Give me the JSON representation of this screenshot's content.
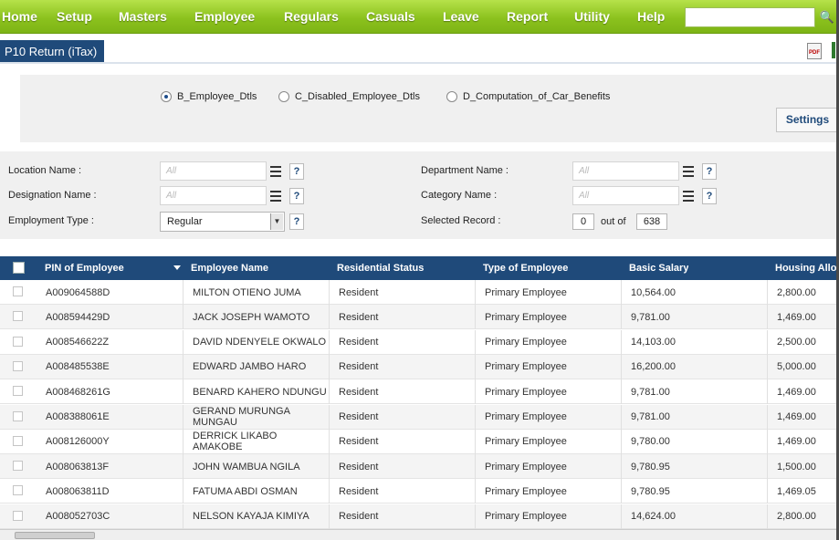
{
  "nav": {
    "items": [
      "Home",
      "Setup",
      "Masters",
      "Employee",
      "Regulars",
      "Casuals",
      "Leave",
      "Report",
      "Utility",
      "Help"
    ],
    "search_icon": "search-icon"
  },
  "page": {
    "title": "P10 Return (iTax)",
    "export_icon": "pdf-export-icon"
  },
  "options": {
    "radios": [
      {
        "label": "B_Employee_Dtls",
        "checked": true
      },
      {
        "label": "C_Disabled_Employee_Dtls",
        "checked": false
      },
      {
        "label": "D_Computation_of_Car_Benefits",
        "checked": false
      }
    ],
    "settings_label": "Settings"
  },
  "filters": {
    "location_label": "Location Name :",
    "designation_label": "Designation Name :",
    "employment_type_label": "Employment Type :",
    "department_label": "Department Name :",
    "category_label": "Category Name :",
    "selected_record_label": "Selected Record :",
    "placeholder": "All",
    "employment_type_value": "Regular",
    "selected_count": "0",
    "out_of_label": "out of",
    "total_count": "638",
    "help_label": "?"
  },
  "table": {
    "columns": [
      "PIN of Employee",
      "Employee Name",
      "Residential Status",
      "Type of Employee",
      "Basic Salary",
      "Housing Allowance"
    ],
    "rows": [
      [
        "A009064588D",
        "MILTON OTIENO JUMA",
        "Resident",
        "Primary Employee",
        "10,564.00",
        "2,800.00"
      ],
      [
        "A008594429D",
        "JACK JOSEPH WAMOTO",
        "Resident",
        "Primary Employee",
        "9,781.00",
        "1,469.00"
      ],
      [
        "A008546622Z",
        "DAVID NDENYELE OKWALO",
        "Resident",
        "Primary Employee",
        "14,103.00",
        "2,500.00"
      ],
      [
        "A008485538E",
        "EDWARD JAMBO HARO",
        "Resident",
        "Primary Employee",
        "16,200.00",
        "5,000.00"
      ],
      [
        "A008468261G",
        "BENARD KAHERO NDUNGU",
        "Resident",
        "Primary Employee",
        "9,781.00",
        "1,469.00"
      ],
      [
        "A008388061E",
        "GERAND MURUNGA MUNGAU",
        "Resident",
        "Primary Employee",
        "9,781.00",
        "1,469.00"
      ],
      [
        "A008126000Y",
        "DERRICK LIKABO AMAKOBE",
        "Resident",
        "Primary Employee",
        "9,780.00",
        "1,469.00"
      ],
      [
        "A008063813F",
        "JOHN WAMBUA NGILA",
        "Resident",
        "Primary Employee",
        "9,780.95",
        "1,500.00"
      ],
      [
        "A008063811D",
        "FATUMA ABDI OSMAN",
        "Resident",
        "Primary Employee",
        "9,780.95",
        "1,469.05"
      ],
      [
        "A008052703C",
        "NELSON KAYAJA KIMIYA",
        "Resident",
        "Primary Employee",
        "14,624.00",
        "2,800.00"
      ]
    ]
  }
}
